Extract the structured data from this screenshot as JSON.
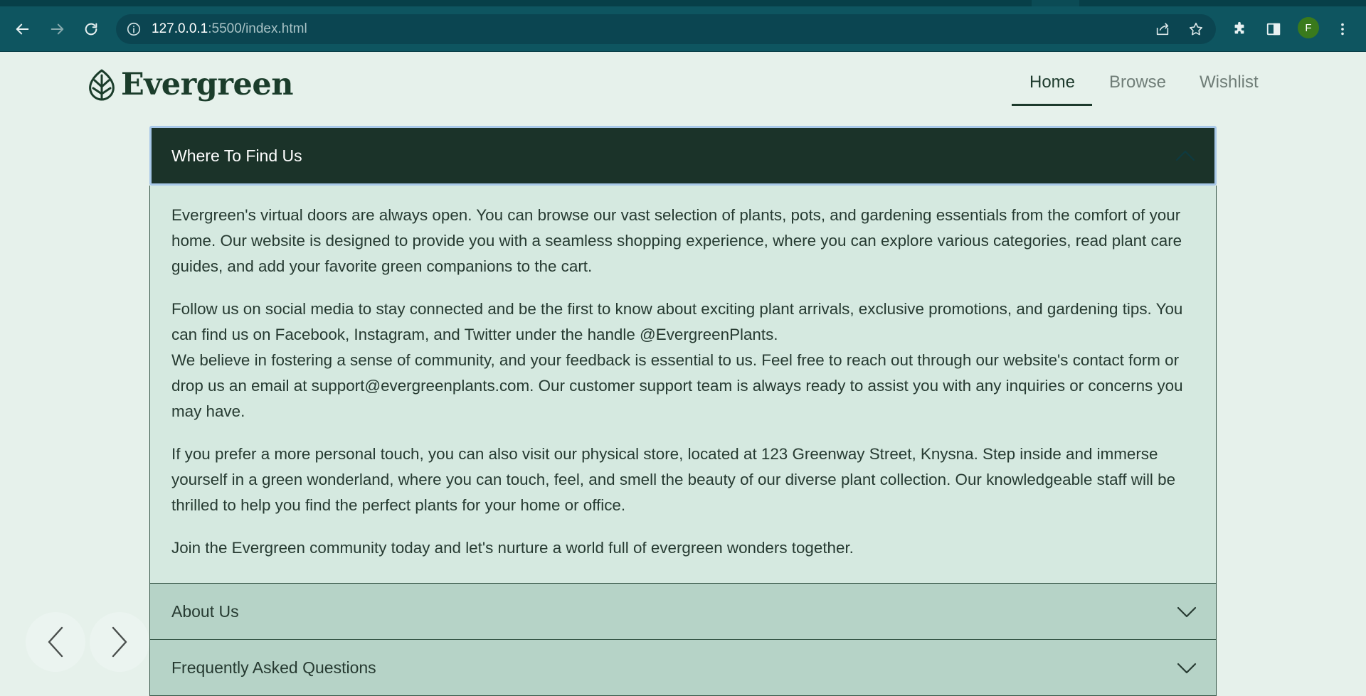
{
  "browser": {
    "url_host": "127.0.0.1",
    "url_rest": ":5500/index.html",
    "profile_initial": "F"
  },
  "site": {
    "logo_text": "Evergreen",
    "nav": [
      {
        "label": "Home",
        "active": true
      },
      {
        "label": "Browse",
        "active": false
      },
      {
        "label": "Wishlist",
        "active": false
      }
    ]
  },
  "accordion": {
    "open_section": {
      "title": "Where To Find Us",
      "paragraphs": [
        "Evergreen's virtual doors are always open. You can browse our vast selection of plants, pots, and gardening essentials from the comfort of your home. Our website is designed to provide you with a seamless shopping experience, where you can explore various categories, read plant care guides, and add your favorite green companions to the cart.",
        "Follow us on social media to stay connected and be the first to know about exciting plant arrivals, exclusive promotions, and gardening tips. You can find us on Facebook, Instagram, and Twitter under the handle @EvergreenPlants.",
        "We believe in fostering a sense of community, and your feedback is essential to us. Feel free to reach out through our website's contact form or drop us an email at support@evergreenplants.com. Our customer support team is always ready to assist you with any inquiries or concerns you may have.",
        "If you prefer a more personal touch, you can also visit our physical store, located at 123 Greenway Street, Knysna. Step inside and immerse yourself in a green wonderland, where you can touch, feel, and smell the beauty of our diverse plant collection. Our knowledgeable staff will be thrilled to help you find the perfect plants for your home or office.",
        "Join the Evergreen community today and let's nurture a world full of evergreen wonders together."
      ]
    },
    "closed_sections": [
      {
        "title": "About Us"
      },
      {
        "title": "Frequently Asked Questions"
      }
    ]
  },
  "colors": {
    "brand_dark": "#1b3329",
    "page_bg": "#e6f1eb",
    "panel_bg": "#d5e9e0",
    "closed_item_bg": "#b6d3c7",
    "browser_toolbar": "#0e5560"
  },
  "icons": [
    "back-arrow-icon",
    "forward-arrow-icon",
    "reload-icon",
    "site-info-icon",
    "share-icon",
    "bookmark-star-icon",
    "extensions-icon",
    "side-panel-icon",
    "kebab-menu-icon",
    "leaf-logo-icon",
    "chevron-up-icon",
    "chevron-down-icon",
    "chevron-left-icon",
    "chevron-right-icon"
  ]
}
